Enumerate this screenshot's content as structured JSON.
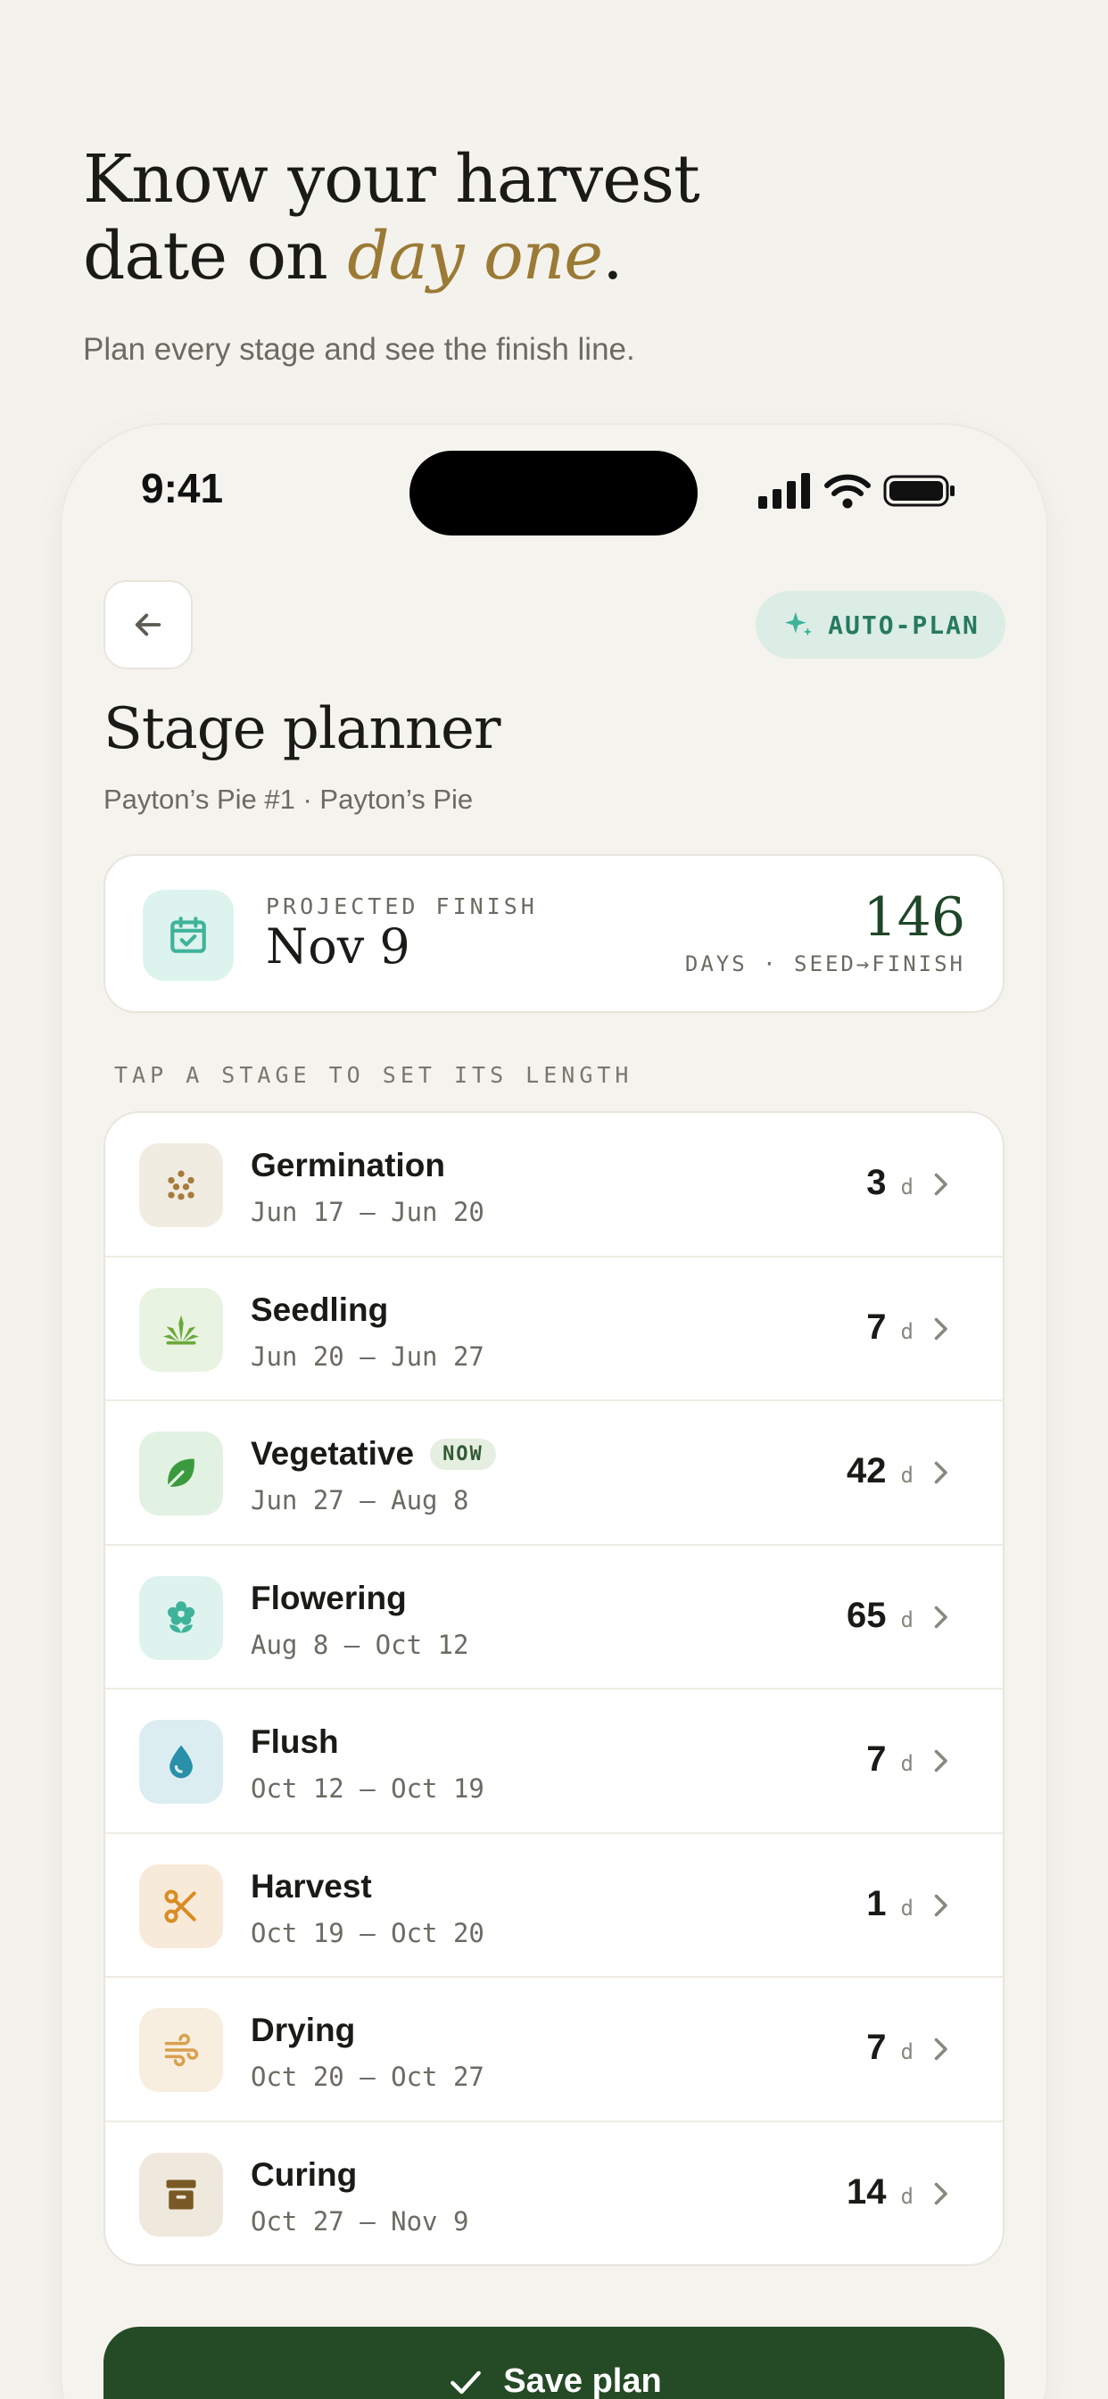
{
  "hero": {
    "headline_line1": "Know your harvest",
    "headline_line2_prefix": "date on ",
    "headline_accent": "day one",
    "headline_suffix": ".",
    "subline": "Plan every stage and see the finish line."
  },
  "status_bar": {
    "time": "9:41"
  },
  "header": {
    "auto_plan_label": "AUTO-PLAN",
    "title": "Stage planner",
    "subtitle": "Payton’s Pie #1 · Payton’s Pie"
  },
  "projection": {
    "label": "PROJECTED FINISH",
    "date": "Nov 9",
    "days": "146",
    "days_label": "DAYS · SEED→FINISH"
  },
  "stages_section": {
    "label": "TAP A STAGE TO SET ITS LENGTH",
    "unit": "d",
    "now_badge": "NOW",
    "items": [
      {
        "name": "Germination",
        "dates": "Jun 17 – Jun 20",
        "days": "3",
        "icon": "seeds-icon",
        "bg": "#f1ece2",
        "color": "#a67c3a"
      },
      {
        "name": "Seedling",
        "dates": "Jun 20 – Jun 27",
        "days": "7",
        "icon": "sprout-icon",
        "bg": "#e9f3e2",
        "color": "#6aa93a"
      },
      {
        "name": "Vegetative",
        "dates": "Jun 27 – Aug 8",
        "days": "42",
        "icon": "leaf-icon",
        "bg": "#e1f2e2",
        "color": "#3c9a3e",
        "current": true
      },
      {
        "name": "Flowering",
        "dates": "Aug 8 – Oct 12",
        "days": "65",
        "icon": "flower-icon",
        "bg": "#dff3ee",
        "color": "#3fb39a"
      },
      {
        "name": "Flush",
        "dates": "Oct 12 – Oct 19",
        "days": "7",
        "icon": "water-drop-icon",
        "bg": "#dcedf2",
        "color": "#2a8fa8"
      },
      {
        "name": "Harvest",
        "dates": "Oct 19 – Oct 20",
        "days": "1",
        "icon": "scissors-icon",
        "bg": "#f8ead9",
        "color": "#d98c24"
      },
      {
        "name": "Drying",
        "dates": "Oct 20 – Oct 27",
        "days": "7",
        "icon": "wind-icon",
        "bg": "#f7eee0",
        "color": "#d9a04c"
      },
      {
        "name": "Curing",
        "dates": "Oct 27 – Nov 9",
        "days": "14",
        "icon": "archive-box-icon",
        "bg": "#efe8dc",
        "color": "#7a5a24"
      }
    ]
  },
  "footer": {
    "save_label": "Save plan"
  },
  "colors": {
    "accent_gold": "#9b7a35",
    "primary_green": "#254a26",
    "mint": "#267a61"
  }
}
